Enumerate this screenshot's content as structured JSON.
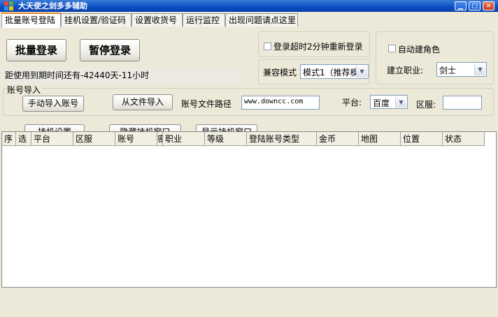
{
  "window": {
    "title": "大天使之剑多多辅助",
    "minimize": "▁",
    "maximize": "□",
    "close": "✕"
  },
  "tabs": [
    "批量账号登陆",
    "挂机设置/验证码",
    "设置收货号",
    "运行监控",
    "出现问题请点这里"
  ],
  "login": {
    "batch_login": "批量登录",
    "pause_login": "暂停登录",
    "expiry": "距使用到期时间还有-42440天-11小时"
  },
  "options": {
    "timeout_relogin": "登录超时2分钟重新登录",
    "compat_label": "兼容模式",
    "compat_value": "模式1（推荐模",
    "auto_role": "自动建角色",
    "job_label": "建立职业:",
    "job_value": "剑士"
  },
  "import": {
    "group_label": "账号导入",
    "manual": "手动导入账号",
    "from_file": "从文件导入",
    "path_label": "账号文件路径",
    "path_value": "www.downcc.com",
    "platform_label": "平台:",
    "platform_value": "百度",
    "server_label": "区服:",
    "server_value": ""
  },
  "actions": {
    "hang_settings": "挂机设置",
    "hide_window": "隐藏挂机窗口",
    "show_window": "显示挂机窗口"
  },
  "table": {
    "columns": [
      "序",
      "选",
      "平台",
      "区服",
      "账号",
      "密",
      "职业",
      "等级",
      "登陆账号类型",
      "金币",
      "地图",
      "位置",
      "状态"
    ]
  },
  "colors": {
    "title_bar": "#0a4cc4",
    "tab_accent": "#e68b2c",
    "panel_bg": "#ece9d8"
  }
}
